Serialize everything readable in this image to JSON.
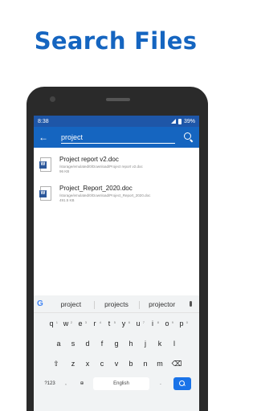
{
  "promo": {
    "title": "Search Files"
  },
  "status_bar": {
    "time": "8:38",
    "battery": "39%"
  },
  "app_bar": {
    "back_icon": "arrow-left-icon",
    "search_value": "project",
    "search_icon": "search-icon"
  },
  "files": [
    {
      "name": "Project report v2.doc",
      "path": "/storage/emulated/0/Download/Project report v2.doc",
      "size": "96 KB",
      "icon": "word-doc-icon"
    },
    {
      "name": "Project_Report_2020.doc",
      "path": "/storage/emulated/0/Download/Project_Report_2020.doc",
      "size": "491.5 KB",
      "icon": "word-doc-icon"
    }
  ],
  "keyboard": {
    "suggestions": [
      "project",
      "projects",
      "projector"
    ],
    "row1": [
      "q",
      "w",
      "e",
      "r",
      "t",
      "y",
      "u",
      "i",
      "o",
      "p"
    ],
    "row1_hints": [
      "1",
      "2",
      "3",
      "4",
      "5",
      "6",
      "7",
      "8",
      "9",
      "0"
    ],
    "row2": [
      "a",
      "s",
      "d",
      "f",
      "g",
      "h",
      "j",
      "k",
      "l"
    ],
    "row3": [
      "z",
      "x",
      "c",
      "v",
      "b",
      "n",
      "m"
    ],
    "shift_glyph": "⇧",
    "delete_glyph": "⌫",
    "symbols_label": "?123",
    "comma": ",",
    "globe_glyph": "⊕",
    "space_label": "English",
    "period": "."
  },
  "colors": {
    "accent": "#1565c0",
    "status_bar": "#1e56a8",
    "word_blue": "#2b579a"
  }
}
